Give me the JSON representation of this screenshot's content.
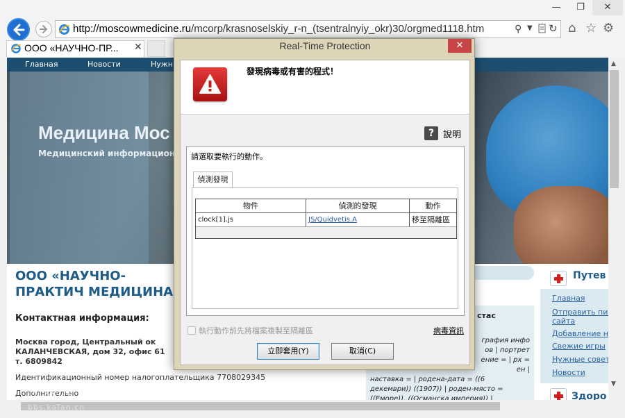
{
  "browser": {
    "url_host": "http://moscowmedicine.ru",
    "url_path": "/mcorp/krasnoselskiy_r-n_(tsentralnyiy_okr)30/orgmed1118.htm",
    "tab_title": "ООО «НАУЧНО-ПР...",
    "window_controls": [
      "—",
      "❐",
      "✕"
    ],
    "tab_close": "✕"
  },
  "site": {
    "nav": [
      "Главная",
      "Новости",
      "Нужн"
    ],
    "title": "Медицина Мос",
    "subtitle": "Медицинский информационн",
    "org_title": "ООО «НАУЧНО-ПРАКТИЧ МЕДИЦИНА»",
    "contact_heading": "Контактная информация:",
    "address_lines": [
      "Москва город, Центральный ок",
      "КАЛАНЧЕВСКАЯ, дом 32, офис 61",
      "т. 6809842"
    ],
    "inn_line": "Идентификационный номер налогоплательщика 7708029345",
    "extra_line": "Дополнительно",
    "mid_heading": "стас",
    "mid_text_lines": [
      "графия инфо",
      "ов | портрет",
      "ение = | px =",
      "ен |",
      "наставка = | родена-дата = ((6",
      "декември)) ((1907)) | роден-място =",
      "((Еморе)), ((Османска империя)) |"
    ],
    "guide_heading": "Путев",
    "guide_links": [
      "Главная",
      "Отправить пис",
      "сайта",
      "Добавление н",
      "Свежие игры",
      "Нужные совет",
      "Новости"
    ],
    "health_heading": "Здоро",
    "watermark": "卡饭论坛",
    "watermark_url": "bbs.kafan.cn"
  },
  "dialog": {
    "title": "Real-Time Protection",
    "close": "✕",
    "message": "發現病毒或有害的程式！",
    "help_label": "說明",
    "help_icon": "?",
    "prompt": "請選取要執行的動作。",
    "tab_label": "偵測發現",
    "columns": [
      "物件",
      "偵測的發現",
      "動作"
    ],
    "rows": [
      {
        "object": "clock[1].js",
        "detection": "JS/Quidvetis.A",
        "action": "移至隔離區"
      }
    ],
    "checkbox_label": "執行動作前先將檔案複製至隔離區",
    "virus_info_link": "病毒資訊",
    "apply_button": "立即套用(Y)",
    "cancel_button": "取消(C)"
  }
}
